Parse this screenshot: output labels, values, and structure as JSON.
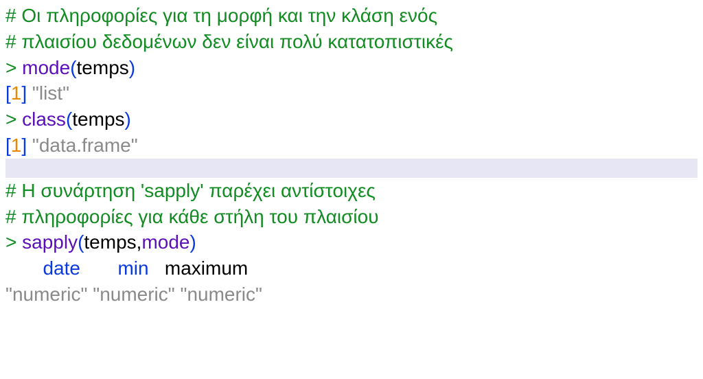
{
  "block1": {
    "comment1": "# Οι πληροφορίες για τη μορφή και την κλάση ενός",
    "comment2": "# πλαισίου δεδομένων δεν είναι πολύ κατατοπιστικές",
    "prompt": "> ",
    "call1": {
      "func": "mode",
      "open": "(",
      "arg": "temps",
      "close": ")"
    },
    "out1": {
      "lb": "[",
      "idx": "1",
      "rb": "]",
      "sp": " ",
      "val": "\"list\""
    },
    "call2": {
      "func": "class",
      "open": "(",
      "arg": "temps",
      "close": ")"
    },
    "out2": {
      "lb": "[",
      "idx": "1",
      "rb": "]",
      "sp": " ",
      "val": "\"data.frame\""
    }
  },
  "block2": {
    "comment1": "# Η συνάρτηση 'sapply' παρέχει αντίστοιχες",
    "comment2": "# πληροφορίες για κάθε στήλη του πλαισίου",
    "prompt": "> ",
    "call": {
      "func": "sapply",
      "open": "(",
      "arg1": "temps",
      "sep": ",",
      "arg2": "mode",
      "close": ")"
    },
    "header": {
      "pad1": "       ",
      "c1": "date",
      "pad2": "       ",
      "c2": "min",
      "pad3": "   ",
      "c3": "maximum"
    },
    "row": {
      "v1": "\"numeric\"",
      "sp1": " ",
      "v2": "\"numeric\"",
      "sp2": " ",
      "v3": "\"numeric\""
    }
  }
}
